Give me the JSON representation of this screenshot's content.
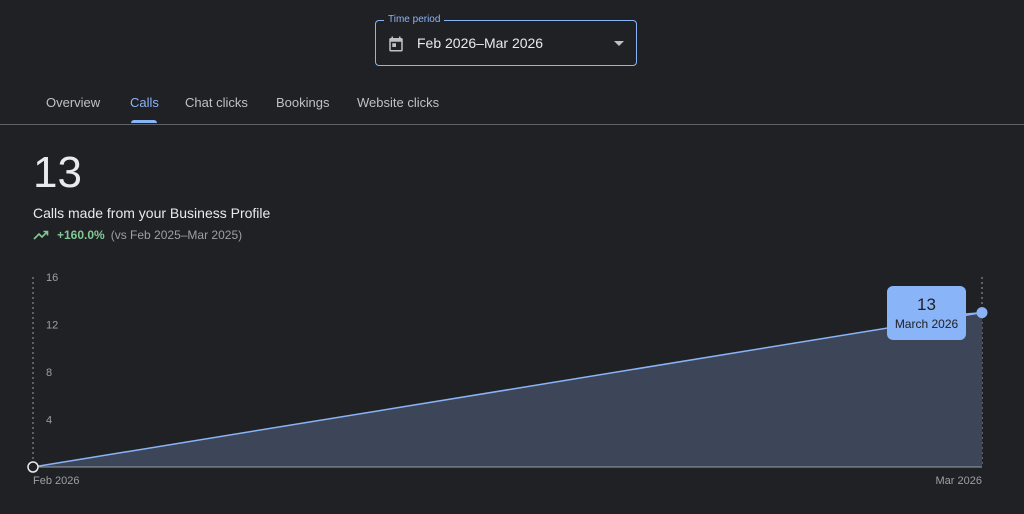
{
  "time_period": {
    "label": "Time period",
    "value": "Feb 2026–Mar 2026",
    "icon": "calendar-icon"
  },
  "tabs": [
    {
      "label": "Overview",
      "active": false
    },
    {
      "label": "Calls",
      "active": true
    },
    {
      "label": "Chat clicks",
      "active": false
    },
    {
      "label": "Bookings",
      "active": false
    },
    {
      "label": "Website clicks",
      "active": false
    }
  ],
  "metric": {
    "value": "13",
    "title": "Calls made from your Business Profile",
    "change": "+160.0%",
    "comparison": "(vs Feb 2025–Mar 2025)",
    "trend_icon": "trending-up-icon"
  },
  "tooltip": {
    "value": "13",
    "label": "March 2026"
  },
  "colors": {
    "accent": "#8ab4f8",
    "positive": "#81c995",
    "area_fill": "#3c4658",
    "background": "#202124"
  },
  "chart_data": {
    "type": "area",
    "x": [
      "Feb 2026",
      "Mar 2026"
    ],
    "values": [
      0,
      13
    ],
    "y_ticks": [
      4,
      8,
      12,
      16
    ],
    "ylim": [
      0,
      16
    ],
    "grid": false
  }
}
